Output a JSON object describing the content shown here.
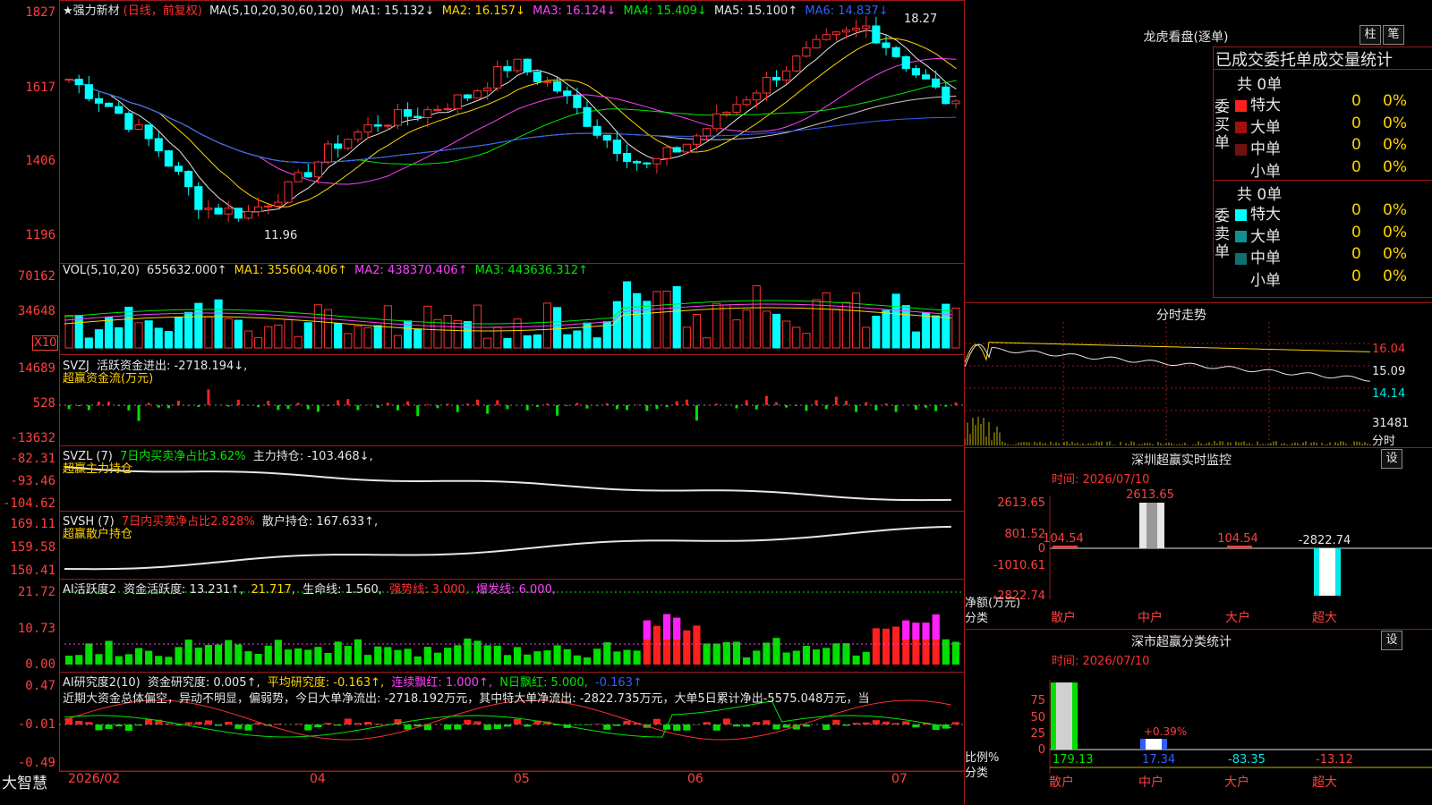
{
  "stock": {
    "name_line": "★强力新材",
    "mode": "(日线，前复权)",
    "ma_params": "MA(5,10,20,30,60,120)",
    "ma1": "MA1: 15.132↓",
    "ma2": "MA2: 16.157↓",
    "ma3": "MA3: 16.124↓",
    "ma4": "MA4: 15.409↓",
    "ma5": "MA5: 15.100↑",
    "ma6": "MA6: 14.837↓",
    "high_mark": "18.27",
    "low_mark": "11.96",
    "y_labels": [
      "1827",
      "1617",
      "1406",
      "1196"
    ]
  },
  "vol": {
    "label": "VOL(5,10,20)",
    "value": "655632.000↑",
    "ma1": "MA1: 355604.406↑",
    "ma2": "MA2: 438370.406↑",
    "ma3": "MA3: 443636.312↑",
    "y_labels": [
      "70162",
      "34648"
    ],
    "unit": "X10"
  },
  "svzj": {
    "label": "SVZJ",
    "text": "活跃资金进出: -2718.194↓,",
    "sub": "超赢资金流(万元)",
    "y_labels": [
      "14689",
      "528",
      "-13632"
    ]
  },
  "svzl": {
    "label": "SVZL (7)",
    "ratio": "7日内买卖净占比3.62%",
    "hold": "主力持仓: -103.468↓,",
    "sub": "超赢主力持仓",
    "y_labels": [
      "-82.31",
      "-93.46",
      "-104.62"
    ]
  },
  "svsh": {
    "label": "SVSH (7)",
    "ratio": "7日内买卖净占比2.828%",
    "hold": "散户持仓: 167.633↑,",
    "sub": "超赢散户持仓",
    "y_labels": [
      "169.11",
      "159.58",
      "150.41"
    ]
  },
  "active": {
    "label": "AI活跃度2",
    "v1": "资金活跃度: 13.231↑,",
    "v2": "21.717,",
    "v3": "生命线: 1.560,",
    "v4": "强势线: 3.000,",
    "v5": "爆发线: 6.000,",
    "y_labels": [
      "21.72",
      "10.73",
      "0.00"
    ]
  },
  "research": {
    "label": "AI研究度2(10)",
    "v1": "资金研究度: 0.005↑,",
    "v2": "平均研究度: -0.163↑,",
    "v3": "连续飘红: 1.000↑,",
    "v4": "N日飘红: 5.000,",
    "v5": "-0.163↑",
    "desc": "近期大资金总体偏空，异动不明显，偏弱势，今日大单净流出: -2718.192万元，其中特大单净流出: -2822.735万元，大单5日累计净出-5575.048万元，当",
    "y_labels": [
      "0.47",
      "-0.01",
      "-0.49"
    ]
  },
  "xaxis": {
    "brand": "大智慧",
    "labels": [
      "2026/02",
      "04",
      "05",
      "06",
      "07"
    ]
  },
  "lhb": {
    "title": "龙虎看盘(逐单)",
    "btn1": "柱",
    "btn2": "笔",
    "header": "已成交委托单成交量统计",
    "buy_label": "委买单",
    "sell_label": "委卖单",
    "buy_total": "共 0单",
    "sell_total": "共 0单",
    "rows_buy": [
      {
        "name": "特大",
        "count": "0",
        "pct": "0%",
        "color": "#ff2020"
      },
      {
        "name": "大单",
        "count": "0",
        "pct": "0%",
        "color": "#a01010"
      },
      {
        "name": "中单",
        "count": "0",
        "pct": "0%",
        "color": "#701010"
      },
      {
        "name": "小单",
        "count": "0",
        "pct": "0%",
        "color": "#000000"
      }
    ],
    "rows_sell": [
      {
        "name": "特大",
        "count": "0",
        "pct": "0%",
        "color": "#00ffff"
      },
      {
        "name": "大单",
        "count": "0",
        "pct": "0%",
        "color": "#109090"
      },
      {
        "name": "中单",
        "count": "0",
        "pct": "0%",
        "color": "#107070"
      },
      {
        "name": "小单",
        "count": "0",
        "pct": "0%",
        "color": "#000000"
      }
    ]
  },
  "intraday": {
    "title": "分时走势",
    "labels": [
      "16.04",
      "15.09",
      "14.14",
      "31481",
      "分时"
    ]
  },
  "monitor": {
    "title": "深圳超赢实时监控",
    "btn": "设",
    "time": "时间: 2026/07/10",
    "y_labels": [
      "2613.65",
      "801.52",
      "0",
      "-1010.61",
      "-2822.74"
    ],
    "unit_line1": "净额(万元)",
    "unit_line2": "分类",
    "bar_labels": [
      "104.54",
      "2613.65",
      "104.54",
      "-2822.74"
    ],
    "categories": [
      "散户",
      "中户",
      "大户",
      "超大"
    ]
  },
  "classify": {
    "title": "深市超赢分类统计",
    "btn": "设",
    "time": "时间: 2026/07/10",
    "y_labels": [
      "75",
      "50",
      "25",
      "0"
    ],
    "unit_line1": "比例%",
    "unit_line2": "分类",
    "pct_label": "+0.39%",
    "values": [
      "179.13",
      "17.34",
      "-83.35",
      "-13.12"
    ],
    "categories": [
      "散户",
      "中户",
      "大户",
      "超大"
    ]
  }
}
